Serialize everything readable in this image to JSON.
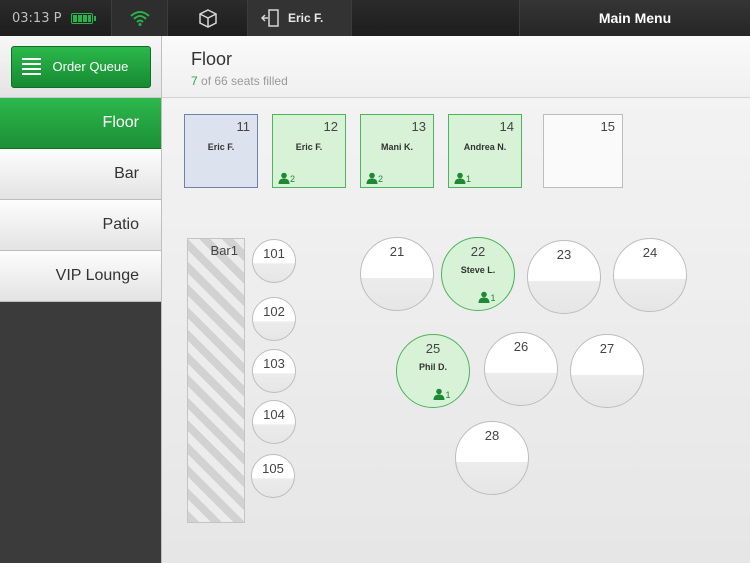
{
  "topbar": {
    "time": "03:13 P",
    "user_name": "Eric F.",
    "main_menu": "Main Menu",
    "icons": {
      "battery": "battery-icon",
      "wifi": "wifi-icon",
      "box": "box-icon",
      "logout": "logout-door-icon"
    },
    "colors": {
      "accent": "#29b34a"
    }
  },
  "sidebar": {
    "order_queue": "Order Queue",
    "sections": [
      {
        "label": "Floor",
        "active": true
      },
      {
        "label": "Bar",
        "active": false
      },
      {
        "label": "Patio",
        "active": false
      },
      {
        "label": "VIP Lounge",
        "active": false
      }
    ]
  },
  "main": {
    "title": "Floor",
    "seats_filled": "7",
    "seats_suffix": " of 66 seats filled"
  },
  "floor": {
    "square_tables": [
      {
        "num": "11",
        "name": "Eric F.",
        "guests": "",
        "state": "selected"
      },
      {
        "num": "12",
        "name": "Eric F.",
        "guests": "2",
        "state": "occupied"
      },
      {
        "num": "13",
        "name": "Mani K.",
        "guests": "2",
        "state": "occupied"
      },
      {
        "num": "14",
        "name": "Andrea N.",
        "guests": "1",
        "state": "occupied"
      },
      {
        "num": "15",
        "name": "",
        "guests": "",
        "state": "empty"
      }
    ],
    "bar_counter": "Bar1",
    "bar_seats": [
      "101",
      "102",
      "103",
      "104",
      "105"
    ],
    "round_tables": [
      {
        "num": "21",
        "name": "",
        "guests": ""
      },
      {
        "num": "22",
        "name": "Steve L.",
        "guests": "1"
      },
      {
        "num": "23",
        "name": "",
        "guests": ""
      },
      {
        "num": "24",
        "name": "",
        "guests": ""
      },
      {
        "num": "25",
        "name": "Phil D.",
        "guests": "1"
      },
      {
        "num": "26",
        "name": "",
        "guests": ""
      },
      {
        "num": "27",
        "name": "",
        "guests": ""
      },
      {
        "num": "28",
        "name": "",
        "guests": ""
      }
    ]
  }
}
